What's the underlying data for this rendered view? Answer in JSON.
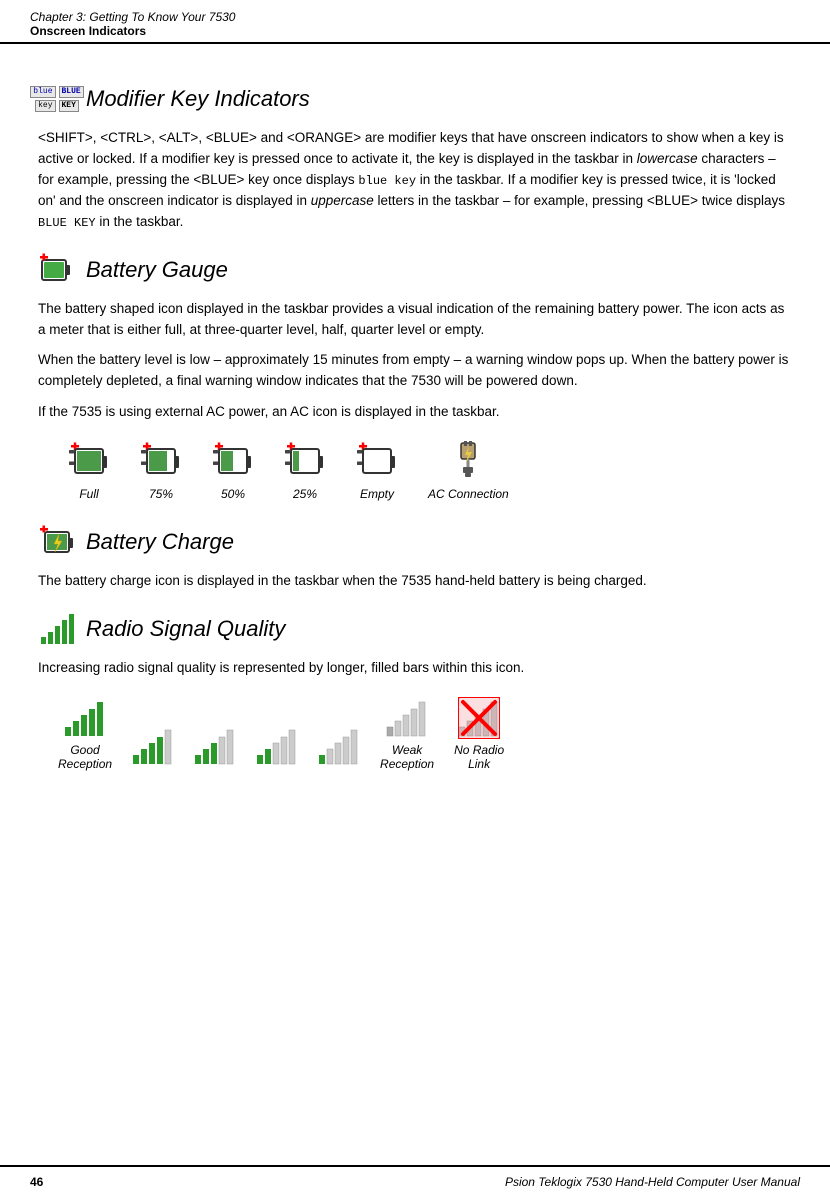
{
  "header": {
    "chapter": "Chapter  3:  Getting To Know Your 7530",
    "section": "Onscreen Indicators"
  },
  "footer": {
    "page_number": "46",
    "book_title": "Psion Teklogix 7530 Hand-Held Computer User Manual"
  },
  "modifier_section": {
    "title": "Modifier  Key  Indicators",
    "body1": "<SHIFT>, <CTRL>, <ALT>, <BLUE> and <ORANGE> are modifier keys that have onscreen indicators to show when a key is active or locked. If a modifier key is pressed once to activate it, the key is displayed in the taskbar in ",
    "body1_italic": "lowercase",
    "body1b": " characters – for example, pressing the <BLUE> key once displays ",
    "body1_mono": "blue key",
    "body1c": " in the taskbar. If a modifier key is pressed twice, it is 'locked on' and the onscreen indicator is displayed in ",
    "body2_italic": "uppercase",
    "body2": " letters in the taskbar – for example, pressing <BLUE> twice displays ",
    "body2_mono": "BLUE KEY",
    "body2b": " in the taskbar."
  },
  "battery_gauge_section": {
    "title": "Battery  Gauge",
    "body1": "The battery shaped icon displayed in the taskbar provides a visual indication of the remaining battery power. The icon acts as a meter that is either full, at three-quarter level, half, quarter level or empty.",
    "body2": "When the battery level is low – approximately 15 minutes from empty – a warning window pops up. When the battery power is completely depleted, a final warning window indicates that the 7530 will be powered down.",
    "body3": "If the 7535 is using external AC power, an AC icon is displayed in the taskbar.",
    "icons": [
      {
        "label": "Full",
        "fill_pct": 100
      },
      {
        "label": "75%",
        "fill_pct": 75
      },
      {
        "label": "50%",
        "fill_pct": 50
      },
      {
        "label": "25%",
        "fill_pct": 25
      },
      {
        "label": "Empty",
        "fill_pct": 0
      },
      {
        "label": "AC Connection",
        "type": "ac"
      }
    ]
  },
  "battery_charge_section": {
    "title": "Battery  Charge",
    "body1": "The battery charge icon is displayed in the taskbar when the 7535 hand-held battery is being charged."
  },
  "radio_signal_section": {
    "title": "Radio  Signal  Quality",
    "body1": "Increasing radio signal quality is represented by longer, filled bars within this icon.",
    "icons": [
      {
        "label": "Good\nReception",
        "bars": 5,
        "filled": 5
      },
      {
        "label": "",
        "bars": 5,
        "filled": 4
      },
      {
        "label": "",
        "bars": 5,
        "filled": 3
      },
      {
        "label": "",
        "bars": 5,
        "filled": 2
      },
      {
        "label": "",
        "bars": 5,
        "filled": 1
      },
      {
        "label": "Weak\nReception",
        "bars": 5,
        "filled": 1,
        "dim": true
      },
      {
        "label": "No  Radio\nLink",
        "bars": 5,
        "filled": 0,
        "crossed": true
      }
    ]
  }
}
